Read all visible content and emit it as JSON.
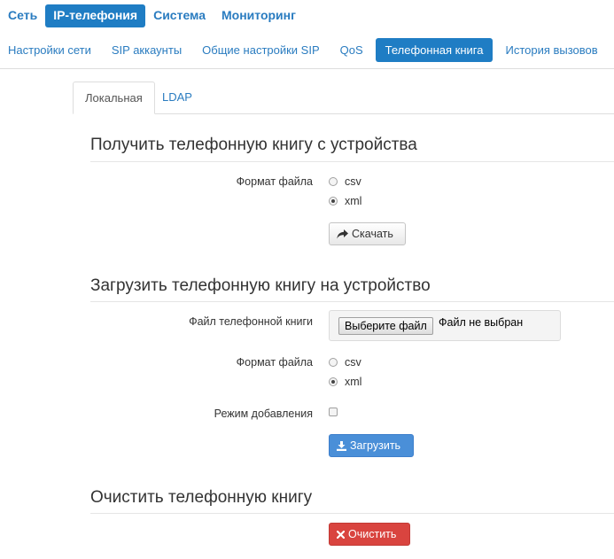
{
  "topnav": {
    "items": [
      {
        "label": "Сеть",
        "active": false
      },
      {
        "label": "IP-телефония",
        "active": true
      },
      {
        "label": "Система",
        "active": false
      },
      {
        "label": "Мониторинг",
        "active": false
      }
    ]
  },
  "subnav": {
    "items": [
      {
        "label": "Настройки сети",
        "active": false
      },
      {
        "label": "SIP аккаунты",
        "active": false
      },
      {
        "label": "Общие настройки SIP",
        "active": false
      },
      {
        "label": "QoS",
        "active": false
      },
      {
        "label": "Телефонная книга",
        "active": true
      },
      {
        "label": "История вызовов",
        "active": false
      }
    ]
  },
  "tabs": {
    "local": "Локальная",
    "ldap": "LDAP"
  },
  "download": {
    "title": "Получить телефонную книгу с устройства",
    "format_label": "Формат файла",
    "options": [
      {
        "label": "csv",
        "checked": false
      },
      {
        "label": "xml",
        "checked": true
      }
    ],
    "button": "Скачать"
  },
  "upload": {
    "title": "Загрузить телефонную книгу на устройство",
    "file_label": "Файл телефонной книги",
    "file_button": "Выберите файл",
    "file_status": "Файл не выбран",
    "format_label": "Формат файла",
    "options": [
      {
        "label": "csv",
        "checked": false
      },
      {
        "label": "xml",
        "checked": true
      }
    ],
    "append_label": "Режим добавления",
    "append_checked": false,
    "button": "Загрузить"
  },
  "clear": {
    "title": "Очистить телефонную книгу",
    "button": "Очистить"
  },
  "colors": {
    "accent": "#1f7dc4",
    "link": "#2a7cc0",
    "primary_button": "#4a8fd8",
    "danger_button": "#d9443f"
  }
}
